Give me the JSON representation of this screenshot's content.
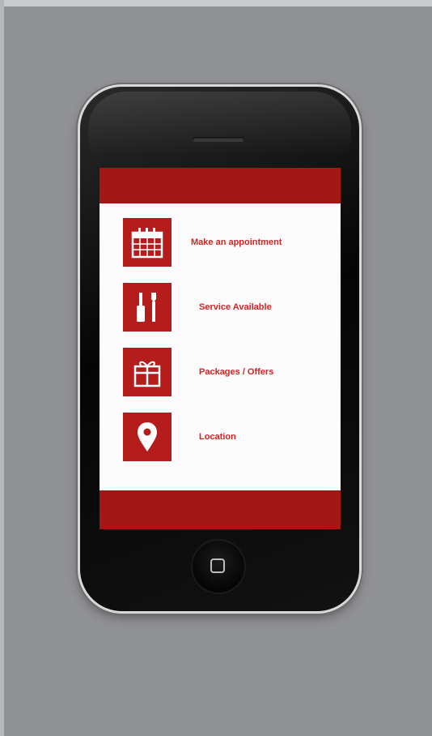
{
  "app": {
    "colors": {
      "background": "#909194",
      "accent": "#a31717",
      "icon_tile": "#b51c1c",
      "label_text": "#d22424",
      "screen": "#fbfbfb"
    }
  },
  "menu": {
    "items": [
      {
        "label": "Make an appointment",
        "icon": "calendar-icon"
      },
      {
        "label": "Service Available",
        "icon": "tools-icon"
      },
      {
        "label": "Packages / Offers",
        "icon": "gift-icon"
      },
      {
        "label": "Location",
        "icon": "location-pin-icon"
      }
    ]
  }
}
